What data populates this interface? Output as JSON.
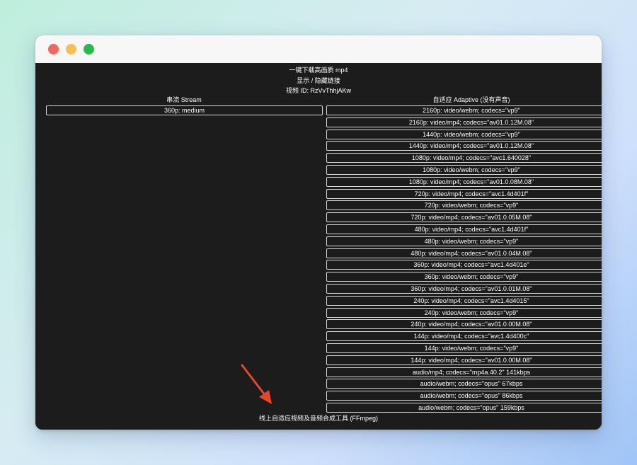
{
  "page": {
    "title": "一键下载高画质 mp4",
    "toggle_link": "显示 / 隐藏链接",
    "video_id": "视频 ID: RzVvThhjAKw"
  },
  "stream": {
    "header": "串流 Stream",
    "items": [
      "360p: medium"
    ]
  },
  "adaptive": {
    "header": "自适应 Adaptive (没有声音)",
    "items": [
      "2160p: video/webm; codecs=\"vp9\"",
      "2160p: video/mp4; codecs=\"av01.0.12M.08\"",
      "1440p: video/webm; codecs=\"vp9\"",
      "1440p: video/mp4; codecs=\"av01.0.12M.08\"",
      "1080p: video/mp4; codecs=\"avc1.640028\"",
      "1080p: video/webm; codecs=\"vp9\"",
      "1080p: video/mp4; codecs=\"av01.0.08M.08\"",
      "720p: video/mp4; codecs=\"avc1.4d401f\"",
      "720p: video/webm; codecs=\"vp9\"",
      "720p: video/mp4; codecs=\"av01.0.05M.08\"",
      "480p: video/mp4; codecs=\"avc1.4d401f\"",
      "480p: video/webm; codecs=\"vp9\"",
      "480p: video/mp4; codecs=\"av01.0.04M.08\"",
      "360p: video/mp4; codecs=\"avc1.4d401e\"",
      "360p: video/webm; codecs=\"vp9\"",
      "360p: video/mp4; codecs=\"av01.0.01M.08\"",
      "240p: video/mp4; codecs=\"avc1.4d4015\"",
      "240p: video/webm; codecs=\"vp9\"",
      "240p: video/mp4; codecs=\"av01.0.00M.08\"",
      "144p: video/mp4; codecs=\"avc1.4d400c\"",
      "144p: video/webm; codecs=\"vp9\"",
      "144p: video/mp4; codecs=\"av01.0.00M.08\"",
      "audio/mp4; codecs=\"mp4a.40.2\" 141kbps",
      "audio/webm; codecs=\"opus\" 67kbps",
      "audio/webm; codecs=\"opus\" 86kbps",
      "audio/webm; codecs=\"opus\" 159kbps"
    ]
  },
  "footer": {
    "tool_link": "线上自适应视频及音频合成工具 (FFmpeg)"
  },
  "colors": {
    "background": "#1c1c1c",
    "arrow": "#e8462b",
    "button_border": "#d8d8d8"
  }
}
